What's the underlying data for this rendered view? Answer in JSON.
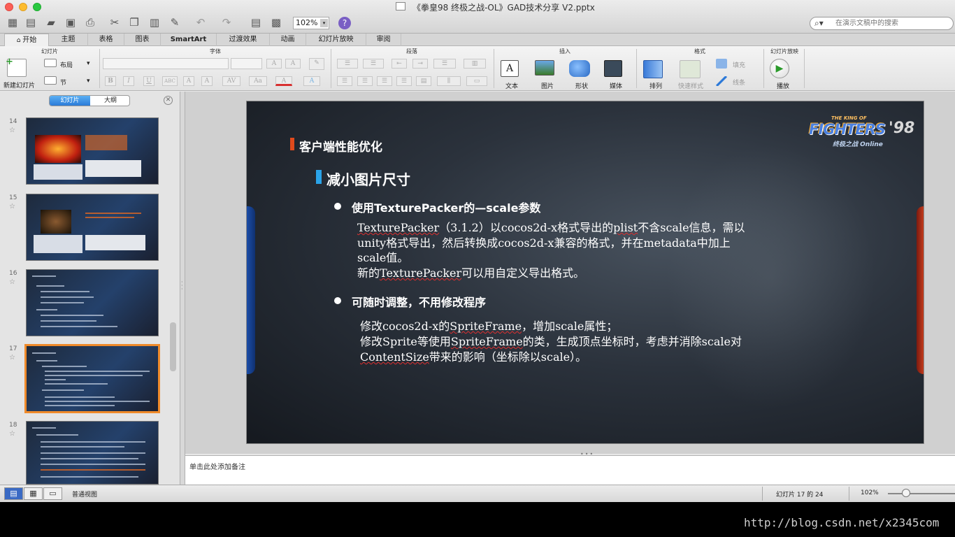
{
  "window": {
    "title": "《拳皇98 终极之战-OL》GAD技术分享 V2.pptx"
  },
  "toolbar": {
    "zoom": "102%",
    "help": "?"
  },
  "search": {
    "placeholder": "在演示文稿中的搜索"
  },
  "tabs": [
    "开始",
    "主题",
    "表格",
    "图表",
    "SmartArt",
    "过渡效果",
    "动画",
    "幻灯片放映",
    "审阅"
  ],
  "ribbon": {
    "groups": {
      "slides": "幻灯片",
      "font": "字体",
      "paragraph": "段落",
      "insert": "插入",
      "format": "格式",
      "slideshow": "幻灯片放映"
    },
    "new_slide": "新建幻灯片",
    "layout": "布局",
    "section": "节",
    "text": "文本",
    "picture": "图片",
    "shape": "形状",
    "media": "媒体",
    "arrange": "排列",
    "quick_styles": "快速样式",
    "fill": "填充",
    "line": "线条",
    "play": "播放"
  },
  "sidebar": {
    "seg_slides": "幻灯片",
    "seg_outline": "大纲",
    "thumbnails": [
      "14",
      "15",
      "16",
      "17",
      "18"
    ]
  },
  "slide": {
    "heading": "客户端性能优化",
    "subheading": "减小图片尺寸",
    "bullet1": "使用TexturePacker的—scale参数",
    "para1_line1": "TexturePacker（3.1.2）以cocos2d-x格式导出的plist不含scale信息，需以",
    "para1_line2": "unity格式导出，然后转换成cocos2d-x兼容的格式，并在metadata中加上",
    "para1_line3": "scale值。",
    "para1_line4": "新的TexturePacker可以用自定义导出格式。",
    "bullet2": "可随时调整，不用修改程序",
    "para2_line1": "修改cocos2d-x的SpriteFrame，增加scale属性；",
    "para2_line2": "修改Sprite等使用SpriteFrame的类，生成顶点坐标时，考虑并消除scale对",
    "para2_line3": "ContentSize带来的影响（坐标除以scale）。",
    "logo_top": "THE KING OF",
    "logo_main": "FIGHTERS",
    "logo_num": "'98",
    "logo_sub": "终极之战 Online"
  },
  "notes": {
    "placeholder": "单击此处添加备注"
  },
  "status": {
    "view": "普通视图",
    "slide_counter": "幻灯片 17 的 24",
    "zoom": "102%"
  },
  "watermark": "http://blog.csdn.net/x2345com",
  "colors": {
    "accent_orange": "#ef8a2a",
    "heading_marker": "#e04a1c",
    "sub_marker": "#2aa3e8"
  }
}
